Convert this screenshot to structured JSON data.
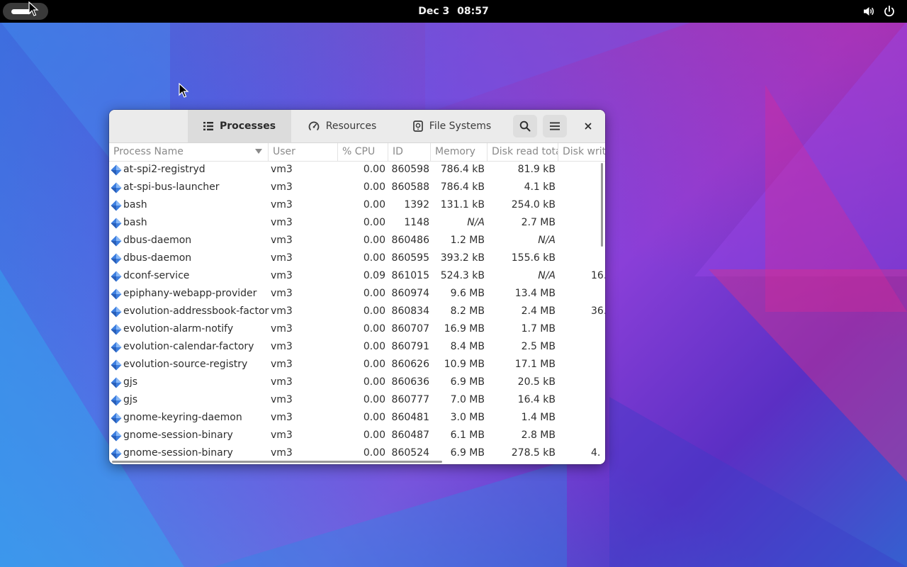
{
  "topbar": {
    "date": "Dec 3",
    "time": "08:57"
  },
  "window": {
    "tabs": [
      {
        "label": "Processes",
        "icon": "list-icon",
        "active": true
      },
      {
        "label": "Resources",
        "icon": "gauge-icon",
        "active": false
      },
      {
        "label": "File Systems",
        "icon": "disk-icon",
        "active": false
      }
    ],
    "columns": [
      "Process Name",
      "User",
      "% CPU",
      "ID",
      "Memory",
      "Disk read tota",
      "Disk writ"
    ],
    "processes": [
      {
        "name": "at-spi2-registryd",
        "user": "vm3",
        "cpu": "0.00",
        "id": "860598",
        "memory": "786.4 kB",
        "disk_read": "81.9 kB",
        "disk_write": ""
      },
      {
        "name": "at-spi-bus-launcher",
        "user": "vm3",
        "cpu": "0.00",
        "id": "860588",
        "memory": "786.4 kB",
        "disk_read": "4.1 kB",
        "disk_write": ""
      },
      {
        "name": "bash",
        "user": "vm3",
        "cpu": "0.00",
        "id": "1392",
        "memory": "131.1 kB",
        "disk_read": "254.0 kB",
        "disk_write": ""
      },
      {
        "name": "bash",
        "user": "vm3",
        "cpu": "0.00",
        "id": "1148",
        "memory": "N/A",
        "disk_read": "2.7 MB",
        "disk_write": ""
      },
      {
        "name": "dbus-daemon",
        "user": "vm3",
        "cpu": "0.00",
        "id": "860486",
        "memory": "1.2 MB",
        "disk_read": "N/A",
        "disk_write": ""
      },
      {
        "name": "dbus-daemon",
        "user": "vm3",
        "cpu": "0.00",
        "id": "860595",
        "memory": "393.2 kB",
        "disk_read": "155.6 kB",
        "disk_write": ""
      },
      {
        "name": "dconf-service",
        "user": "vm3",
        "cpu": "0.09",
        "id": "861015",
        "memory": "524.3 kB",
        "disk_read": "N/A",
        "disk_write": "16."
      },
      {
        "name": "epiphany-webapp-provider",
        "user": "vm3",
        "cpu": "0.00",
        "id": "860974",
        "memory": "9.6 MB",
        "disk_read": "13.4 MB",
        "disk_write": ""
      },
      {
        "name": "evolution-addressbook-factory",
        "user": "vm3",
        "cpu": "0.00",
        "id": "860834",
        "memory": "8.2 MB",
        "disk_read": "2.4 MB",
        "disk_write": "36."
      },
      {
        "name": "evolution-alarm-notify",
        "user": "vm3",
        "cpu": "0.00",
        "id": "860707",
        "memory": "16.9 MB",
        "disk_read": "1.7 MB",
        "disk_write": ""
      },
      {
        "name": "evolution-calendar-factory",
        "user": "vm3",
        "cpu": "0.00",
        "id": "860791",
        "memory": "8.4 MB",
        "disk_read": "2.5 MB",
        "disk_write": ""
      },
      {
        "name": "evolution-source-registry",
        "user": "vm3",
        "cpu": "0.00",
        "id": "860626",
        "memory": "10.9 MB",
        "disk_read": "17.1 MB",
        "disk_write": ""
      },
      {
        "name": "gjs",
        "user": "vm3",
        "cpu": "0.00",
        "id": "860636",
        "memory": "6.9 MB",
        "disk_read": "20.5 kB",
        "disk_write": ""
      },
      {
        "name": "gjs",
        "user": "vm3",
        "cpu": "0.00",
        "id": "860777",
        "memory": "7.0 MB",
        "disk_read": "16.4 kB",
        "disk_write": ""
      },
      {
        "name": "gnome-keyring-daemon",
        "user": "vm3",
        "cpu": "0.00",
        "id": "860481",
        "memory": "3.0 MB",
        "disk_read": "1.4 MB",
        "disk_write": ""
      },
      {
        "name": "gnome-session-binary",
        "user": "vm3",
        "cpu": "0.00",
        "id": "860487",
        "memory": "6.1 MB",
        "disk_read": "2.8 MB",
        "disk_write": ""
      },
      {
        "name": "gnome-session-binary",
        "user": "vm3",
        "cpu": "0.00",
        "id": "860524",
        "memory": "6.9 MB",
        "disk_read": "278.5 kB",
        "disk_write": "4."
      }
    ]
  }
}
